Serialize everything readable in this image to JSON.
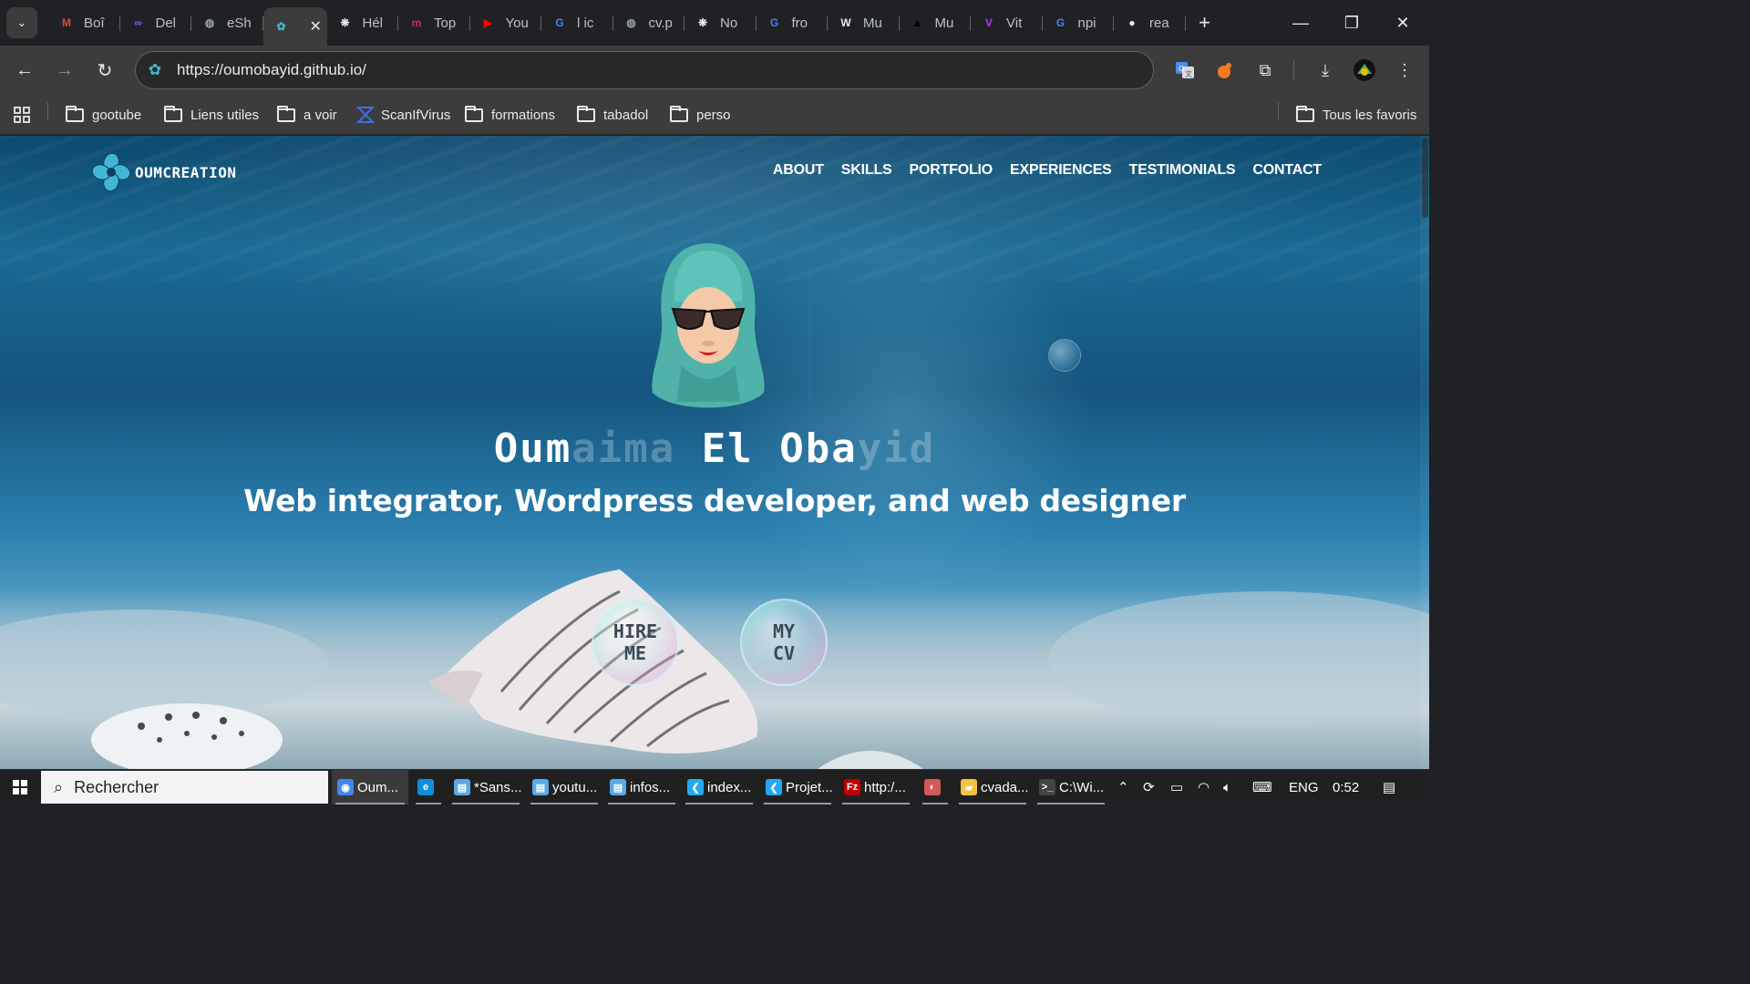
{
  "browser": {
    "tab_search_icon": "chevron-down-icon",
    "tabs": [
      {
        "title": "Boî",
        "icon": "gmail-icon",
        "color": "#ea4335"
      },
      {
        "title": "Del",
        "icon": "infinity-icon",
        "color": "#7b61ff"
      },
      {
        "title": "eSh",
        "icon": "globe-icon",
        "color": "#9aa0a6"
      },
      {
        "title": "",
        "icon": "oumcreation-icon",
        "color": "#43b6d6",
        "active": true
      },
      {
        "title": "Hél",
        "icon": "openai-icon",
        "color": "#e8eaed"
      },
      {
        "title": "Top",
        "icon": "m-logo-icon",
        "color": "#e91e63"
      },
      {
        "title": "You",
        "icon": "youtube-icon",
        "color": "#ff0000"
      },
      {
        "title": "l ic",
        "icon": "google-icon",
        "color": "#4285f4"
      },
      {
        "title": "cv.p",
        "icon": "globe-icon",
        "color": "#9aa0a6"
      },
      {
        "title": "No",
        "icon": "openai-icon",
        "color": "#e8eaed"
      },
      {
        "title": "fro",
        "icon": "google-icon",
        "color": "#4285f4"
      },
      {
        "title": "Mu",
        "icon": "mui-w-icon",
        "color": "#e8eaed"
      },
      {
        "title": "Mu",
        "icon": "triangle-icon",
        "color": "#000000"
      },
      {
        "title": "Vit",
        "icon": "vite-icon",
        "color": "#bd34fe"
      },
      {
        "title": "npi",
        "icon": "google-icon",
        "color": "#4285f4"
      },
      {
        "title": "rea",
        "icon": "github-icon",
        "color": "#e8eaed"
      }
    ],
    "new_tab_label": "+",
    "window_controls": {
      "minimize": "—",
      "restore": "❐",
      "close": "✕"
    },
    "url": "https://oumobayid.github.io/",
    "bookmarks": [
      {
        "label": "gootube",
        "type": "folder"
      },
      {
        "label": "Liens utiles",
        "type": "folder"
      },
      {
        "label": "a voir",
        "type": "folder"
      },
      {
        "label": "ScanIfVirus",
        "type": "link"
      },
      {
        "label": "formations",
        "type": "folder"
      },
      {
        "label": "tabadol",
        "type": "folder"
      },
      {
        "label": "perso",
        "type": "folder"
      }
    ],
    "all_bookmarks_label": "Tous les favoris"
  },
  "page": {
    "logo_text": "OUMCREATION",
    "nav": [
      "ABOUT",
      "SKILLS",
      "PORTFOLIO",
      "EXPERIENCES",
      "TESTIMONIALS",
      "CONTACT"
    ],
    "hero_name_parts": [
      "Oum",
      "aima",
      " ",
      "El",
      " ",
      "Oba",
      "yid"
    ],
    "hero_subtitle": "Web integrator, Wordpress developer, and web designer",
    "hire_me_line1": "HIRE",
    "hire_me_line2": "ME",
    "cv_line1": "MY",
    "cv_line2": "CV"
  },
  "taskbar": {
    "search_placeholder": "Rechercher",
    "apps": [
      {
        "label": "Oum...",
        "icon": "chrome-icon",
        "color": "#4285f4",
        "active": true
      },
      {
        "label": "",
        "icon": "edge-icon",
        "color": "#0f8fd8"
      },
      {
        "label": "*Sans...",
        "icon": "notepad-icon",
        "color": "#5aa9e6"
      },
      {
        "label": "youtu...",
        "icon": "notepad-icon",
        "color": "#5aa9e6"
      },
      {
        "label": "infos...",
        "icon": "notepad-icon",
        "color": "#5aa9e6"
      },
      {
        "label": "index...",
        "icon": "vscode-icon",
        "color": "#23a9f2"
      },
      {
        "label": "Projet...",
        "icon": "vscode-icon",
        "color": "#23a9f2"
      },
      {
        "label": "http:/...",
        "icon": "filezilla-icon",
        "color": "#bf0000"
      },
      {
        "label": "",
        "icon": "paint-icon",
        "color": "#d25a5a"
      },
      {
        "label": "cvada...",
        "icon": "folder-icon",
        "color": "#f3c23c"
      },
      {
        "label": "C:\\Wi...",
        "icon": "cmd-icon",
        "color": "#444444"
      }
    ],
    "tray": {
      "language": "ENG",
      "time": "0:52"
    }
  }
}
